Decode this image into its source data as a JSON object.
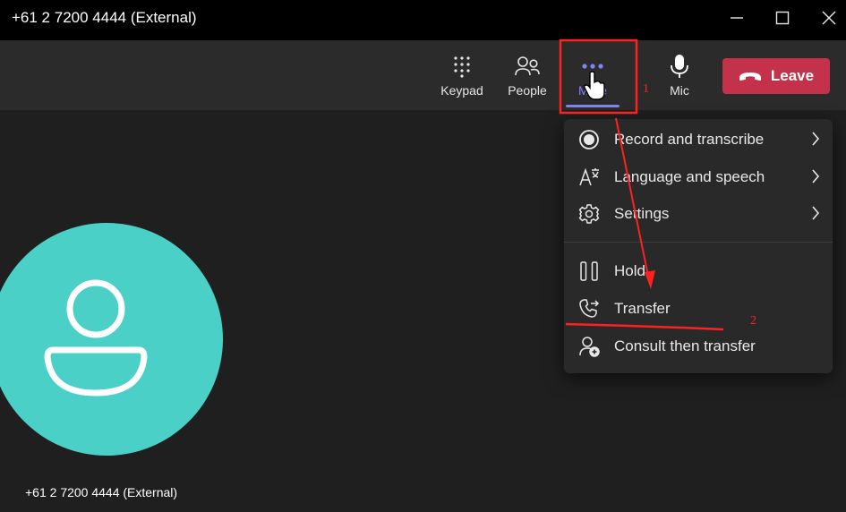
{
  "window": {
    "title": "+61 2 7200 4444 (External)",
    "controls": [
      "minimize-icon",
      "maximize-icon",
      "close-icon"
    ]
  },
  "toolbar": {
    "keypad_label": "Keypad",
    "people_label": "People",
    "more_label": "More",
    "mic_label": "Mic",
    "leave_label": "Leave"
  },
  "caller": {
    "name": "+61 2 7200 4444 (External)"
  },
  "more_menu": {
    "items": [
      {
        "label": "Record and transcribe",
        "icon": "record-icon",
        "submenu": true
      },
      {
        "label": "Language and speech",
        "icon": "language-icon",
        "submenu": true
      },
      {
        "label": "Settings",
        "icon": "gear-icon",
        "submenu": true
      },
      {
        "label": "Hold",
        "icon": "pause-icon",
        "submenu": false
      },
      {
        "label": "Transfer",
        "icon": "transfer-icon",
        "submenu": false
      },
      {
        "label": "Consult then transfer",
        "icon": "consult-transfer-icon",
        "submenu": false
      }
    ]
  },
  "annotations": {
    "step1": "1",
    "step2": "2"
  },
  "colors": {
    "accent": "#7f85f5",
    "leave": "#c4314b",
    "avatar": "#4bd0c8",
    "annotation": "#ff2020"
  }
}
